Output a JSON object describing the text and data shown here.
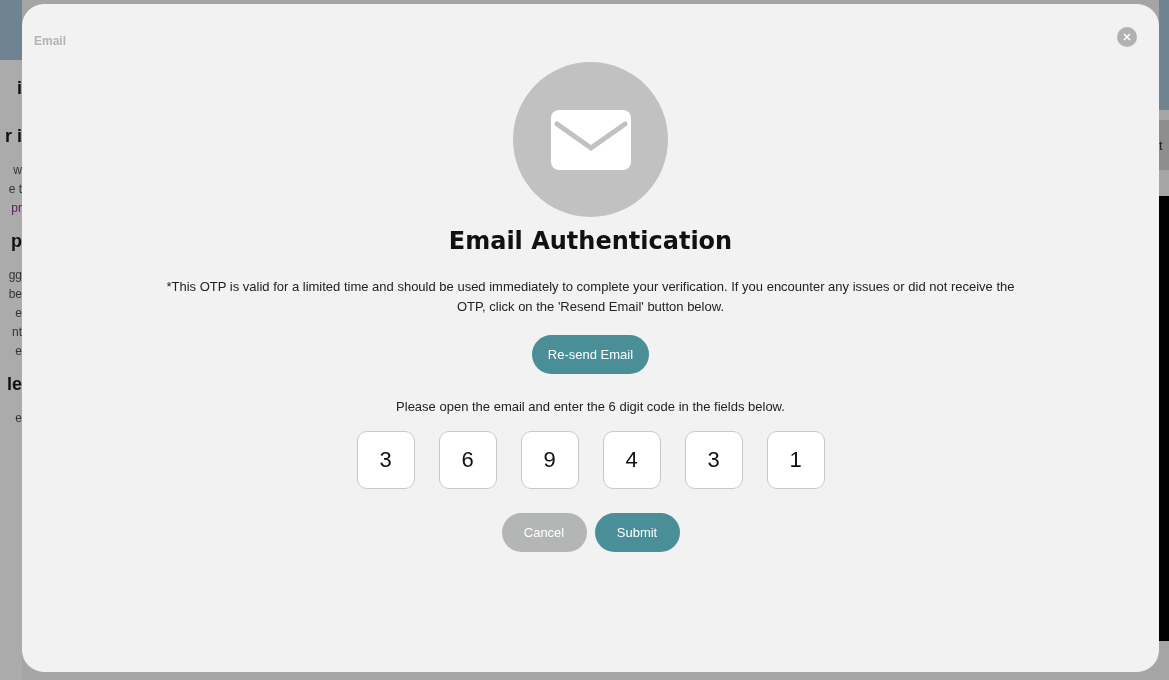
{
  "background": {
    "left_fragments": [
      {
        "text": "i",
        "kind": "heading"
      },
      {
        "text": "r i",
        "kind": "heading"
      },
      {
        "text": "w",
        "kind": "body"
      },
      {
        "text": "e t",
        "kind": "body"
      },
      {
        "text": "pr",
        "kind": "link"
      },
      {
        "text": "p",
        "kind": "heading"
      },
      {
        "text": "gg",
        "kind": "body"
      },
      {
        "text": "be",
        "kind": "body"
      },
      {
        "text": "e",
        "kind": "body"
      },
      {
        "text": "nt",
        "kind": "body"
      },
      {
        "text": "e",
        "kind": "body"
      },
      {
        "text": "le",
        "kind": "heading"
      },
      {
        "text": "e",
        "kind": "body"
      }
    ],
    "right_fragment": "t"
  },
  "modal": {
    "label": "Email",
    "title": "Email Authentication",
    "notice": "*This OTP is valid for a limited time and should be used immediately to complete your verification. If you encounter any issues or did not receive the OTP, click on the 'Resend Email' button below.",
    "resend_button": "Re-send Email",
    "instruction": "Please open the email and enter the 6 digit code in the fields below.",
    "otp_fields": [
      {
        "value": "3"
      },
      {
        "value": "6"
      },
      {
        "value": "9"
      },
      {
        "value": "4"
      },
      {
        "value": "3"
      },
      {
        "value": "1"
      }
    ],
    "buttons": [
      {
        "label": "Cancel",
        "kind": "secondary"
      },
      {
        "label": "Submit",
        "kind": "primary"
      }
    ]
  }
}
